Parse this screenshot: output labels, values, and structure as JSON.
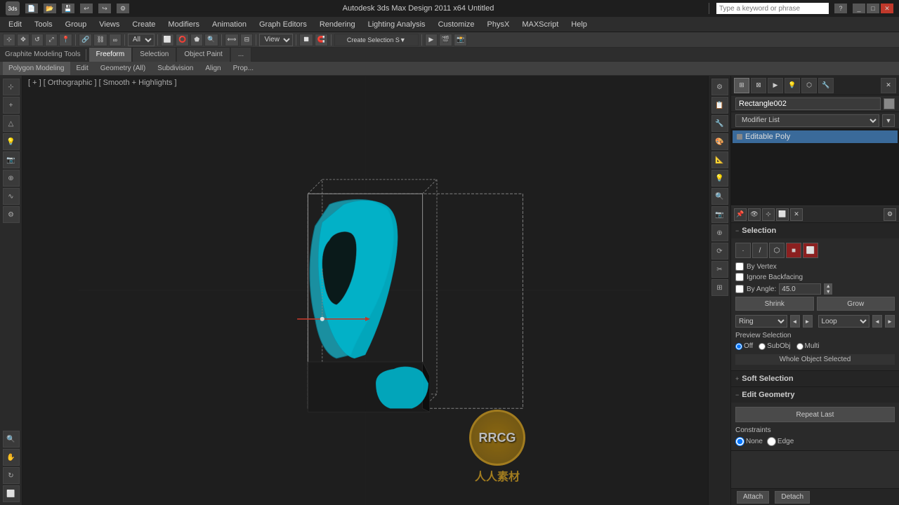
{
  "titlebar": {
    "title": "Autodesk 3ds Max Design 2011 x64    Untitled",
    "search_placeholder": "Type a keyword or phrase"
  },
  "menubar": {
    "items": [
      "Edit",
      "Tools",
      "Group",
      "Views",
      "Create",
      "Modifiers",
      "Animation",
      "Graph Editors",
      "Rendering",
      "Lighting Analysis",
      "Customize",
      "PhysX",
      "MAXScript",
      "Help"
    ]
  },
  "graphite_toolbar": {
    "label": "Graphite Modeling Tools",
    "tabs": [
      "Freeform",
      "Selection",
      "Object Paint",
      "..."
    ]
  },
  "subtabs": {
    "items": [
      "Polygon Modeling",
      "Edit",
      "Geometry (All)",
      "Subdivision",
      "Align",
      "Prop..."
    ]
  },
  "viewport": {
    "label": "[ + ] [ Orthographic ] [ Smooth + Highlights ]"
  },
  "right_panel": {
    "obj_name": "Rectangle002",
    "obj_color": "#888888",
    "modifier_list_label": "Modifier List",
    "modifier_stack": [
      {
        "name": "Editable Poly",
        "selected": true
      }
    ],
    "selection": {
      "title": "Selection",
      "by_vertex": false,
      "ignore_backfacing": false,
      "by_angle": false,
      "angle_value": "45.0",
      "shrink_label": "Shrink",
      "grow_label": "Grow",
      "ring_label": "Ring",
      "loop_label": "Loop",
      "preview_label": "Preview Selection",
      "off_label": "Off",
      "subobj_label": "SubObj",
      "multi_label": "Multi",
      "whole_object": "Whole Object Selected"
    },
    "soft_selection": {
      "title": "Soft Selection"
    },
    "edit_geometry": {
      "title": "Edit Geometry",
      "repeat_last": "Repeat Last",
      "constraints_label": "Constraints",
      "none_label": "None",
      "edge_label": "Edge"
    },
    "bottom_btns": [
      "Attach",
      "Detach"
    ]
  },
  "icons": {
    "arrow_up": "▲",
    "arrow_down": "▼",
    "arrow_right": "▶",
    "collapse": "−",
    "expand": "+",
    "dot": "●",
    "square": "■",
    "triangle": "▲",
    "cursor": "⊹",
    "move": "✥",
    "rotate": "↺",
    "scale": "⤢",
    "pin": "📌"
  }
}
